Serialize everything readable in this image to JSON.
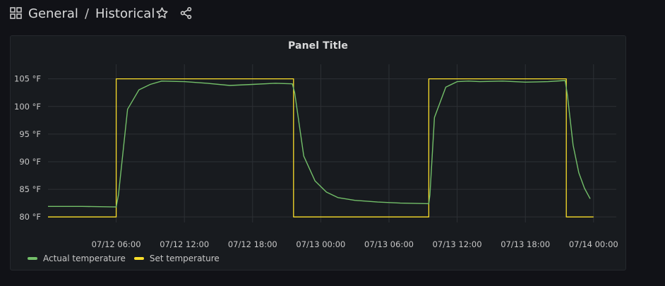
{
  "breadcrumb": {
    "folder": "General",
    "separator": "/",
    "dashboard": "Historical"
  },
  "icons": {
    "apps": "grid-icon",
    "favorite": "star-icon",
    "share": "share-icon"
  },
  "panel": {
    "title": "Panel Title"
  },
  "colors": {
    "background": "#111217",
    "panel": "#181b1f",
    "actual": "#73bf69",
    "set": "#fade2a",
    "grid": "#2c3035"
  },
  "chart_data": {
    "type": "line",
    "title": "Panel Title",
    "y_unit": "°F",
    "ylim": [
      79,
      107
    ],
    "yticks": [
      "80 °F",
      "85 °F",
      "90 °F",
      "95 °F",
      "100 °F",
      "105 °F"
    ],
    "ytick_values": [
      80,
      85,
      90,
      95,
      100,
      105
    ],
    "xlim": [
      "07/12 00:00",
      "07/14 02:00"
    ],
    "xticks": [
      "07/12 06:00",
      "07/12 12:00",
      "07/12 18:00",
      "07/13 00:00",
      "07/13 06:00",
      "07/13 12:00",
      "07/13 18:00",
      "07/14 00:00"
    ],
    "xtick_hours": [
      6,
      12,
      18,
      24,
      30,
      36,
      42,
      48
    ],
    "grid": true,
    "legend_position": "bottom-left",
    "series": [
      {
        "name": "Actual temperature",
        "color": "#73bf69",
        "x_hours": [
          0,
          3,
          6,
          6.2,
          7,
          8,
          9,
          10,
          12,
          14,
          16,
          18,
          20,
          21.5,
          21.7,
          22.5,
          23.5,
          24.5,
          25.5,
          27,
          29,
          31,
          33.5,
          33.6,
          34,
          35,
          36,
          37,
          38,
          40,
          42,
          44,
          45.5,
          45.7,
          46.2,
          46.7,
          47.2,
          47.7
        ],
        "y": [
          81.9,
          81.9,
          81.8,
          84,
          99.5,
          103,
          104,
          104.6,
          104.5,
          104.2,
          103.8,
          104,
          104.2,
          104.1,
          102.5,
          91,
          86.5,
          84.5,
          83.5,
          83,
          82.7,
          82.5,
          82.4,
          84,
          98,
          103.5,
          104.5,
          104.6,
          104.5,
          104.6,
          104.4,
          104.5,
          104.7,
          102,
          93,
          88,
          85.2,
          83.3
        ]
      },
      {
        "name": "Set temperature",
        "color": "#fade2a",
        "x_hours": [
          0,
          6,
          6,
          21.6,
          21.6,
          33.5,
          33.5,
          45.6,
          45.6,
          48
        ],
        "y": [
          80,
          80,
          105,
          105,
          80,
          80,
          105,
          105,
          80,
          80
        ]
      }
    ]
  }
}
